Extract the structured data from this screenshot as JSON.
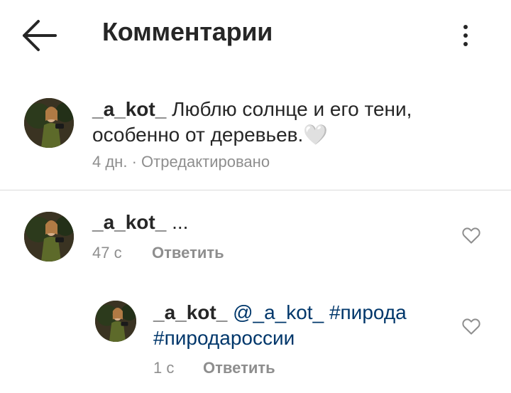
{
  "header": {
    "title": "Комментарии"
  },
  "caption": {
    "username": "_a_kot_",
    "text_line1": "Люблю солнце и его тени,",
    "text_line2": "особенно от деревьев.",
    "emoji": "🤍",
    "time": "4 дн.",
    "separator": "·",
    "edited": "Отредактировано"
  },
  "comments": [
    {
      "username": "_a_kot_",
      "text": "...",
      "time": "47 с",
      "reply_label": "Ответить"
    },
    {
      "username": "_a_kot_",
      "mention": "@_a_kot_",
      "hashtag1": "#пирода",
      "hashtag2": "#пиродароссии",
      "time": "1 с",
      "reply_label": "Ответить"
    }
  ],
  "icons": {
    "back": "arrow-left-icon",
    "more": "more-vertical-icon",
    "like": "heart-outline-icon"
  },
  "colors": {
    "text": "#262626",
    "muted": "#8e8e8e",
    "link": "#00376b",
    "divider": "#dbdbdb"
  }
}
